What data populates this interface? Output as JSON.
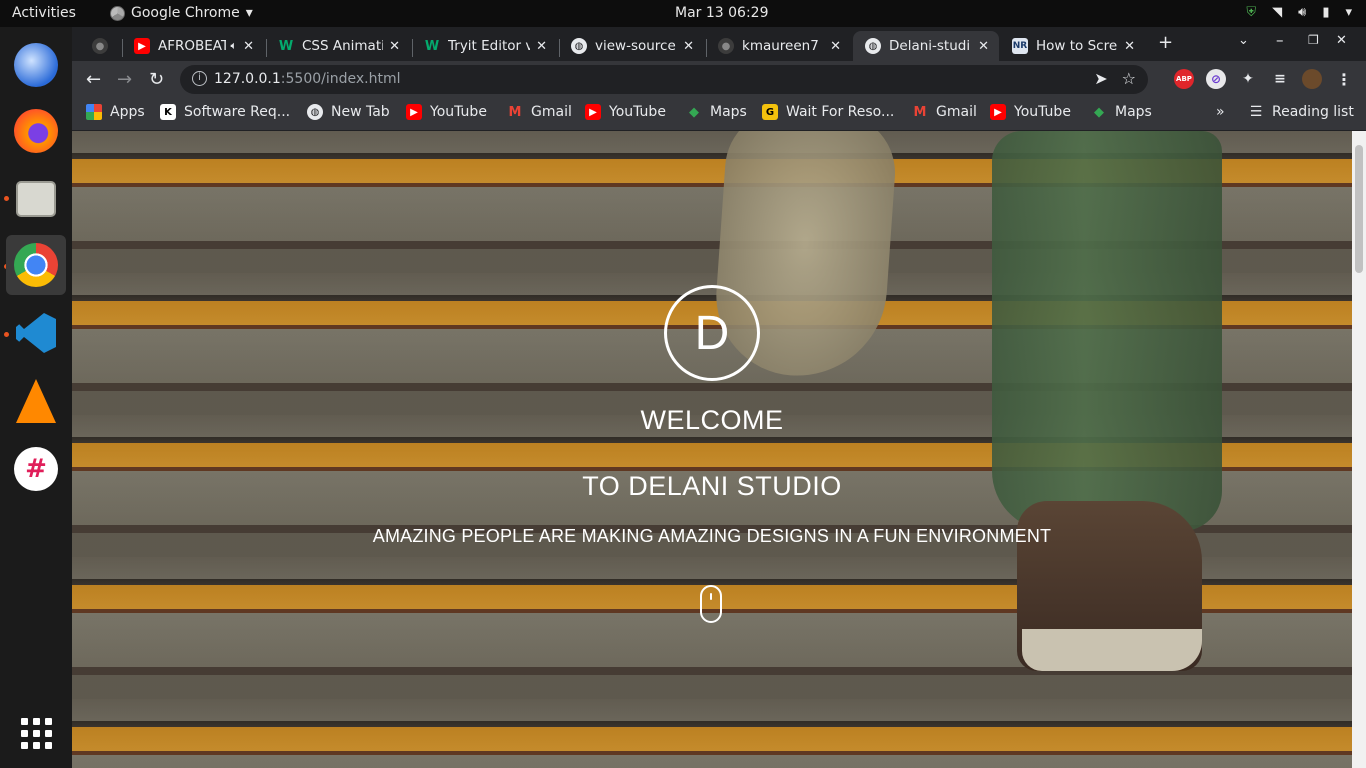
{
  "system": {
    "activities": "Activities",
    "app_name": "Google Chrome",
    "clock": "Mar 13  06:29"
  },
  "tabs": [
    {
      "label": ""
    },
    {
      "label": "AFROBEAT"
    },
    {
      "label": "CSS Animati"
    },
    {
      "label": "Tryit Editor v"
    },
    {
      "label": "view-source"
    },
    {
      "label": "kmaureen7"
    },
    {
      "label": "Delani-studi"
    },
    {
      "label": "How to Scre"
    }
  ],
  "address_bar": {
    "host": "127.0.0.1",
    "path": ":5500/index.html"
  },
  "bookmarks": [
    {
      "label": "Apps"
    },
    {
      "label": "Software Req..."
    },
    {
      "label": "New Tab"
    },
    {
      "label": "YouTube"
    },
    {
      "label": "Gmail"
    },
    {
      "label": "YouTube"
    },
    {
      "label": "Maps"
    },
    {
      "label": "Wait For Reso..."
    },
    {
      "label": "Gmail"
    },
    {
      "label": "YouTube"
    },
    {
      "label": "Maps"
    }
  ],
  "reading_list": "Reading list",
  "hero": {
    "logo_letter": "D",
    "welcome": "WELCOME",
    "studio": "TO DELANI STUDIO",
    "tagline": "AMAZING PEOPLE ARE MAKING AMAZING DESIGNS IN A FUN ENVIRONMENT"
  },
  "extensions": {
    "abp": "ABP"
  },
  "colors": {
    "chrome_dark": "#202124",
    "toolbar": "#35363a",
    "dock": "#1b1b1b",
    "ubuntu_orange": "#e95420",
    "stair_yellow": "#f2a92d"
  }
}
